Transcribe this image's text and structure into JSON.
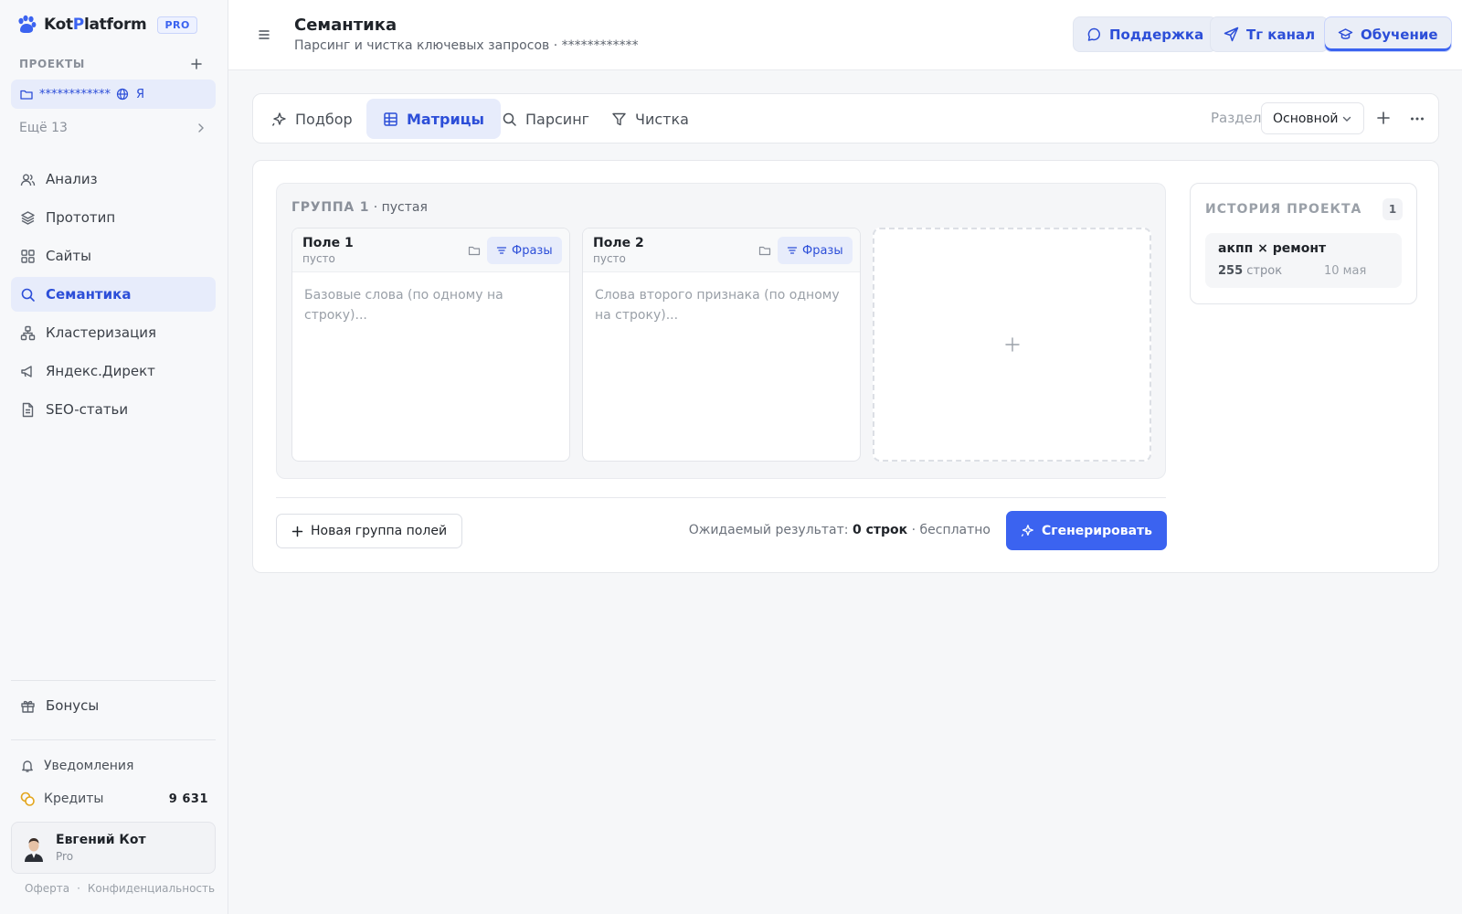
{
  "app": {
    "logo_part1": "Kot",
    "logo_part2": "P",
    "logo_part3": "latform",
    "badge": "PRO"
  },
  "sidebar": {
    "projects_title": "ПРОЕКТЫ",
    "current_project": {
      "name": "************",
      "engine": "Я"
    },
    "more_label": "Ещё 13",
    "items": [
      {
        "label": "Анализ",
        "icon": "users-icon"
      },
      {
        "label": "Прототип",
        "icon": "layers-icon"
      },
      {
        "label": "Сайты",
        "icon": "grid-icon"
      },
      {
        "label": "Семантика",
        "icon": "search-icon",
        "active": true
      },
      {
        "label": "Кластеризация",
        "icon": "cluster-icon"
      },
      {
        "label": "Яндекс.Директ",
        "icon": "megaphone-icon"
      },
      {
        "label": "SEO-статьи",
        "icon": "document-icon"
      }
    ],
    "bonus_label": "Бонусы",
    "notifications_label": "Уведомления",
    "credits_label": "Кредиты",
    "credits_value": "9 631",
    "user": {
      "name": "Евгений Кот",
      "plan": "Pro"
    },
    "footer": {
      "offer": "Оферта",
      "dot": "·",
      "privacy": "Конфиденциальность"
    }
  },
  "header": {
    "title": "Семантика",
    "subtitle": "Парсинг и чистка ключевых запросов · ************",
    "buttons": [
      {
        "label": "Поддержка",
        "icon": "chat-icon"
      },
      {
        "label": "Тг канал",
        "icon": "send-icon"
      },
      {
        "label": "Обучение",
        "icon": "graduation-icon"
      }
    ]
  },
  "tabs": {
    "items": [
      {
        "label": "Подбор",
        "icon": "sparkle-icon"
      },
      {
        "label": "Матрицы",
        "icon": "table-icon",
        "active": true
      },
      {
        "label": "Парсинг",
        "icon": "search-icon"
      },
      {
        "label": "Чистка",
        "icon": "filter-icon"
      }
    ],
    "section_label": "Раздел",
    "section_value": "Основной"
  },
  "group": {
    "title": "ГРУППА 1",
    "status": "· пустая",
    "fields": [
      {
        "name": "Поле 1",
        "state": "пусто",
        "phrases_label": "Фразы",
        "placeholder": "Базовые слова (по одному на строку)..."
      },
      {
        "name": "Поле 2",
        "state": "пусто",
        "phrases_label": "Фразы",
        "placeholder": "Слова второго признака (по одному на строку)..."
      }
    ]
  },
  "history": {
    "title": "ИСТОРИЯ ПРОЕКТА",
    "count": "1",
    "items": [
      {
        "name": "акпп × ремонт",
        "rows": "255",
        "rows_label": "строк",
        "date": "10 мая"
      }
    ]
  },
  "footer_actions": {
    "new_group": "Новая группа полей",
    "result_prefix": "Ожидаемый результат:",
    "result_value": "0 строк",
    "result_suffix": "· бесплатно",
    "generate": "Сгенерировать"
  },
  "colors": {
    "accent": "#3b63f0",
    "active_bg": "#e7ecfb"
  }
}
